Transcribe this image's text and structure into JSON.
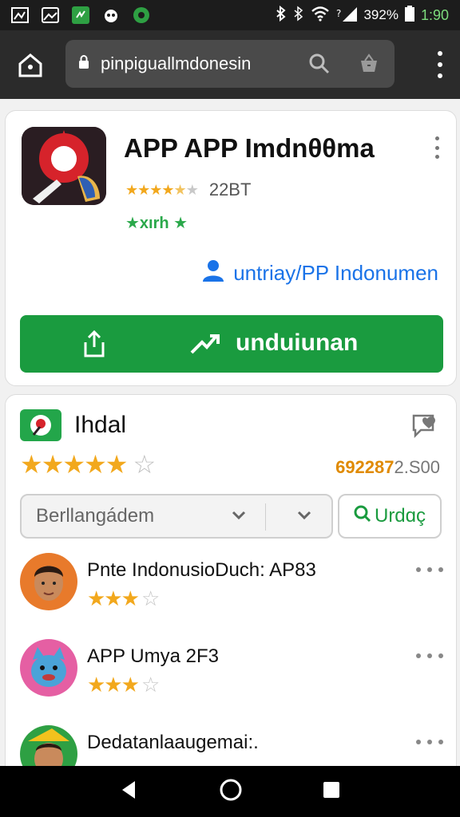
{
  "status_bar": {
    "battery": "392%",
    "time": "1:90"
  },
  "browser": {
    "url": "pinpiguallmdonesin",
    "icons": [
      "home-icon",
      "lock-icon",
      "search-icon",
      "basket-icon",
      "overflow-menu-icon"
    ]
  },
  "app": {
    "title": "APP APP Imdnθθma",
    "rating_count": "22BT",
    "stars_filled": 4.5,
    "badge_text": "★xırh ★",
    "developer_link": "untriay/PP Indonumen",
    "install_label": "unduiunan"
  },
  "reviews": {
    "title": "Ihdal",
    "overall_count": "692287",
    "overall_count_suffix": "2.S00",
    "sort_label": "Berllangádem",
    "update_label": "Urdɑç",
    "items": [
      {
        "name": "Pnte IndonusioDuch: AP83",
        "stars": 3
      },
      {
        "name": "APP Umya 2F3",
        "stars": 3
      },
      {
        "name": "Dedatanlaaugemai:.",
        "stars": 0
      }
    ]
  },
  "colors": {
    "accent_green": "#1a9b3f",
    "link_blue": "#1a73e8",
    "star_orange": "#f2a81d"
  }
}
